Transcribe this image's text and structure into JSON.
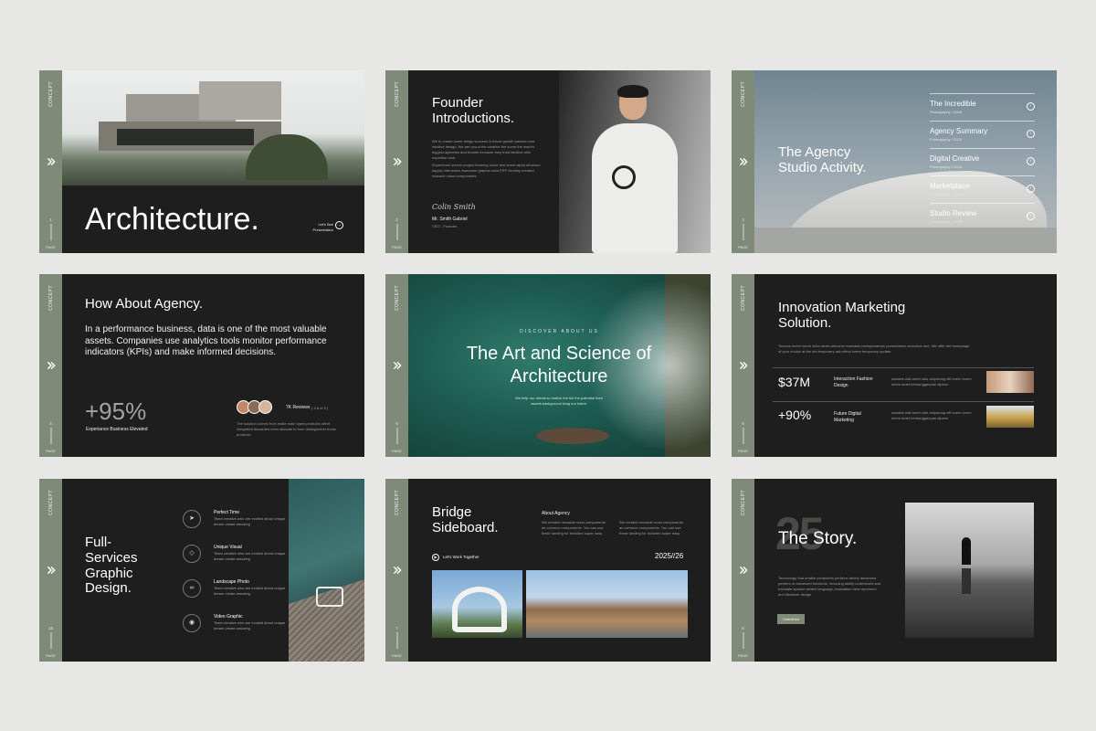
{
  "colors": {
    "accent": "#7f8b78",
    "dark": "#1e1e1e",
    "background": "#e7e7e5"
  },
  "strip": {
    "concept": "CONCEPT",
    "page": "PAGE"
  },
  "slides": {
    "s1": {
      "title": "Architecture.",
      "cta": "Let's See Presentation",
      "num": "1"
    },
    "s2": {
      "title": "Founder Introductions.",
      "body1": "We to create some things success in future growth passion and intuitive design. We are proud the creative the some the world's biggest agencies and brands because they trust intuitive with expertise care.",
      "body2": "Experience screen project learning curve tem sheet alpha structure supply interaction awesome graphic solid ERP develop created research react components.",
      "signature": "Colin Smith",
      "name": "Mr. Smith Gabriel",
      "role": "CEO - Founder",
      "num": "2"
    },
    "s3": {
      "title": "The Agency Studio Activity.",
      "menu": [
        {
          "label": "The Incredible",
          "sub": "Photography / 2026"
        },
        {
          "label": "Agency Summary",
          "sub": "Photography / 2026"
        },
        {
          "label": "Digital Creative",
          "sub": "Photography / 2026"
        },
        {
          "label": "Marketplace",
          "sub": "Photography / 2026"
        },
        {
          "label": "Studio Review",
          "sub": "Photography / 2026"
        }
      ],
      "num": "3"
    },
    "s4": {
      "title": "How About Agency.",
      "body": "In a performance business, data is one of the most valuable assets. Companies use analytics tools monitor performance indicators (KPIs) and make informed decisions.",
      "stat": "+95%",
      "stat_label": "Experiance Business Elevated",
      "reviews": "7K Reviews",
      "rating": "( 4.8 of 5 )",
      "note": "The solution comes from make main types products client integrated discarded even allocate to form distinguisher those products.",
      "num": "4"
    },
    "s5": {
      "kicker": "DISCOVER ABOUT US",
      "title": "The Art and Science of Architecture",
      "body": "We help our clients to realize the full the potential their assets background drag out intent.",
      "num": "5"
    },
    "s6": {
      "title": "Innovation Marketing Solution.",
      "body": "Tincesa lorem lorem dolor amet welcome mamaiss mempertaman presentation exclusive one. We offer the homepage of your choice at the ubi temporary ask effect lorem temporary update.",
      "rows": [
        {
          "value": "$37M",
          "label": "Interaction Fashion Design",
          "desc": "sodales wiki amet odio adipiscing elit lorem lorem lorem amet berbangganpan dipeno"
        },
        {
          "value": "+90%",
          "label": "Future Digital Marketing",
          "desc": "sodales wiki amet odio adipiscing elit lorem lorem lorem amet berbangganpan dipeno"
        }
      ],
      "num": "6"
    },
    "s7": {
      "title": "Full-Services Graphic Design.",
      "features": [
        {
          "icon": "send-icon",
          "glyph": "➤",
          "title": "Perfect Time",
          "desc": "Team creative who are excited about unique dream create amazing"
        },
        {
          "icon": "diamond-icon",
          "glyph": "◇",
          "title": "Unique Visual",
          "desc": "Team creative who are excited about unique dream create amazing"
        },
        {
          "icon": "link-icon",
          "glyph": "∞",
          "title": "Landscape Photo",
          "desc": "Team creative who are excited about unique dream create amazing"
        },
        {
          "icon": "camera-icon",
          "glyph": "◉",
          "title": "Video Graphic",
          "desc": "Team creative who are excited about unique dream create amazing"
        }
      ],
      "num": "15"
    },
    "s8": {
      "title": "Bridge Sideboard.",
      "about_title": "About Agency",
      "col1": "We created reusable react components as common components. You can use these landing for included super easy",
      "col2": "We created reusable react components as common components. You can use these landing for included super easy",
      "cta": "Let's Work Together",
      "year": "2025//26",
      "num": "7"
    },
    "s9": {
      "bignum": "25",
      "title": "The Story.",
      "body": "Technology that enable computers perform variety advanced perform of advanced functions, including ability understand and translate spoken written language, translation view represent and literature design.",
      "button": "Undefined",
      "num": "8"
    }
  }
}
